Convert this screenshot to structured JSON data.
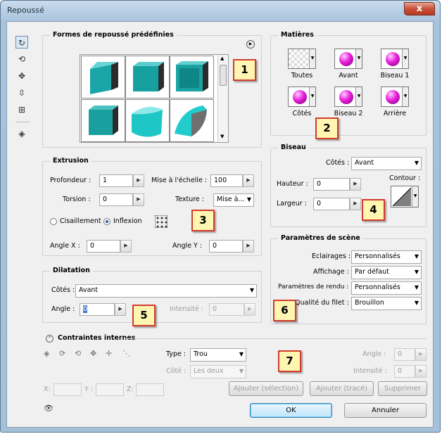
{
  "window": {
    "title": "Repoussé",
    "close": "x"
  },
  "notes": [
    "1",
    "2",
    "3",
    "4",
    "5",
    "6",
    "7"
  ],
  "formes": {
    "title": "Formes de repoussé prédéfinies"
  },
  "matieres": {
    "title": "Matières",
    "items": [
      "Toutes",
      "Avant",
      "Biseau 1",
      "Côtés",
      "Biseau 2",
      "Arrière"
    ]
  },
  "extrusion": {
    "title": "Extrusion",
    "profondeur_label": "Profondeur :",
    "profondeur": "1",
    "echelle_label": "Mise à l'échelle :",
    "echelle": "100",
    "torsion_label": "Torsion :",
    "torsion": "0",
    "texture_label": "Texture :",
    "texture": "Mise à...",
    "cisaillement": "Cisaillement",
    "inflexion": "Inflexion",
    "anglex_label": "Angle X :",
    "anglex": "0",
    "angley_label": "Angle Y :",
    "angley": "0"
  },
  "biseau": {
    "title": "Biseau",
    "cotes_label": "Côtés :",
    "cotes": "Avant",
    "hauteur_label": "Hauteur :",
    "hauteur": "0",
    "largeur_label": "Largeur :",
    "largeur": "0",
    "contour_label": "Contour :"
  },
  "scene": {
    "title": "Paramètres de scène",
    "eclairages_label": "Eclairages :",
    "eclairages": "Personnalisés",
    "affichage_label": "Affichage :",
    "affichage": "Par défaut",
    "rendu_label": "Paramètres de rendu :",
    "rendu": "Personnalisés",
    "qualite_label": "Qualité du filet :",
    "qualite": "Brouillon"
  },
  "dilatation": {
    "title": "Dilatation",
    "cotes_label": "Côtés :",
    "cotes": "Avant",
    "angle_label": "Angle :",
    "angle": "0",
    "intensite_label": "Intensité :",
    "intensite": "0"
  },
  "contraintes": {
    "title": "Contraintes internes",
    "type_label": "Type :",
    "type": "Trou",
    "cote_label": "Côté :",
    "cote": "Les deux",
    "angle_label": "Angle :",
    "angle": "0",
    "intensite_label": "Intensité :",
    "intensite": "0",
    "x_label": "X:",
    "y_label": "Y :",
    "z_label": "Z:",
    "add_sel": "Ajouter (sélection)",
    "add_trace": "Ajouter (tracé)",
    "delete": "Supprimer"
  },
  "buttons": {
    "ok": "OK",
    "cancel": "Annuler"
  }
}
